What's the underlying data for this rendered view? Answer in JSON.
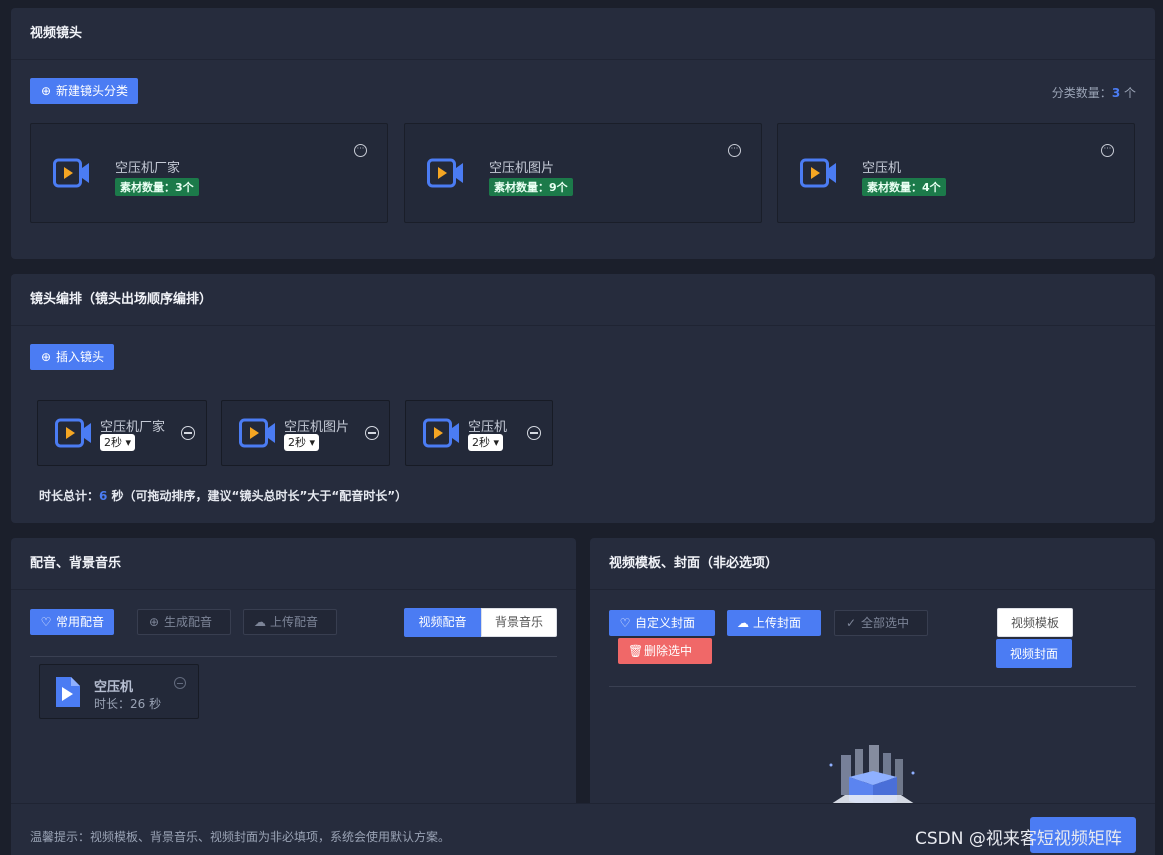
{
  "shots": {
    "title": "视频镜头",
    "new_category_btn": "新建镜头分类",
    "count_label": "分类数量：",
    "count_value": "3",
    "count_unit": " 个",
    "categories": [
      {
        "name": "空压机厂家",
        "badge": "素材数量：3个"
      },
      {
        "name": "空压机图片",
        "badge": "素材数量：9个"
      },
      {
        "name": "空压机",
        "badge": "素材数量：4个"
      }
    ]
  },
  "arrange": {
    "title": "镜头编排（镜头出场顺序编排）",
    "insert_btn": "插入镜头",
    "items": [
      {
        "name": "空压机厂家",
        "duration": "2秒 ▾"
      },
      {
        "name": "空压机图片",
        "duration": "2秒 ▾"
      },
      {
        "name": "空压机",
        "duration": "2秒 ▾"
      }
    ],
    "total_prefix": "时长总计：",
    "total_value": "6",
    "total_suffix": " 秒（可拖动排序，建议“镜头总时长”大于“配音时长”）"
  },
  "audio": {
    "title": "配音、背景音乐",
    "common_btn": "常用配音",
    "generate_btn": "生成配音",
    "upload_btn": "上传配音",
    "tabs": [
      "视频配音",
      "背景音乐"
    ],
    "file_name": "空压机",
    "file_duration": "时长：26 秒"
  },
  "template": {
    "title": "视频模板、封面（非必选项）",
    "custom_cover_btn": "自定义封面",
    "upload_cover_btn": "上传封面",
    "select_all_btn": "全部选中",
    "delete_selected_btn": "删除选中",
    "tabs": [
      "视频模板",
      "视频封面"
    ]
  },
  "footer": {
    "tip": "温馨提示：视频模板、背景音乐、视频封面为非必填项，系统会使用默认方案。",
    "watermark": "CSDN @视来客短视频矩阵"
  },
  "colors": {
    "accent": "#4b7cf3",
    "badge_green": "#1c7a4a",
    "danger": "#f06868",
    "panel": "#262c3d"
  }
}
